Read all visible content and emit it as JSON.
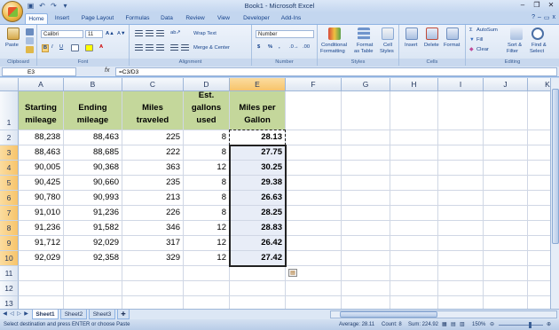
{
  "window": {
    "title": "Book1 - Microsoft Excel",
    "controls": [
      "–",
      "❐",
      "✕"
    ]
  },
  "ribbon_tabs": [
    "Home",
    "Insert",
    "Page Layout",
    "Formulas",
    "Data",
    "Review",
    "View",
    "Developer",
    "Add-Ins"
  ],
  "ribbon": {
    "clipboard": {
      "paste": "Paste",
      "label": "Clipboard"
    },
    "font": {
      "name": "Calibri",
      "size": "11",
      "label": "Font"
    },
    "alignment": {
      "wrap_text": "Wrap Text",
      "merge": "Merge & Center",
      "label": "Alignment"
    },
    "number": {
      "format": "Number",
      "label": "Number"
    },
    "styles": {
      "conditional": "Conditional",
      "conditional2": "Formatting",
      "format_as": "Format",
      "format_as2": "as Table",
      "cell": "Cell",
      "cell2": "Styles",
      "label": "Styles"
    },
    "cells": {
      "insert": "Insert",
      "delete": "Delete",
      "format": "Format",
      "label": "Cells"
    },
    "editing": {
      "autosum": "AutoSum",
      "fill": "Fill",
      "clear": "Clear",
      "sort": "Sort &",
      "sort2": "Filter",
      "find": "Find &",
      "find2": "Select",
      "label": "Editing"
    }
  },
  "formula_bar": {
    "name_box": "E3",
    "fx": "fx",
    "formula": "=C3/D3"
  },
  "columns": [
    "A",
    "B",
    "C",
    "D",
    "E",
    "F",
    "G",
    "H",
    "I",
    "J",
    "K"
  ],
  "rows": [
    "1",
    "2",
    "3",
    "4",
    "5",
    "6",
    "7",
    "8",
    "9",
    "10",
    "11",
    "12",
    "13"
  ],
  "headers": [
    "Starting mileage",
    "Ending mileage",
    "Miles traveled",
    "Est. gallons used",
    "Miles per Gallon"
  ],
  "data_rows": [
    [
      "88,238",
      "88,463",
      "225",
      "8",
      "28.13"
    ],
    [
      "88,463",
      "88,685",
      "222",
      "8",
      "27.75"
    ],
    [
      "90,005",
      "90,368",
      "363",
      "12",
      "30.25"
    ],
    [
      "90,425",
      "90,660",
      "235",
      "8",
      "29.38"
    ],
    [
      "90,780",
      "90,993",
      "213",
      "8",
      "26.63"
    ],
    [
      "91,010",
      "91,236",
      "226",
      "8",
      "28.25"
    ],
    [
      "91,236",
      "91,582",
      "346",
      "12",
      "28.83"
    ],
    [
      "91,712",
      "92,029",
      "317",
      "12",
      "26.42"
    ],
    [
      "92,029",
      "92,358",
      "329",
      "12",
      "27.42"
    ]
  ],
  "sheets": [
    "Sheet1",
    "Sheet2",
    "Sheet3"
  ],
  "status": {
    "message": "Select destination and press ENTER or choose Paste",
    "average": "Average: 28.11",
    "count": "Count: 8",
    "sum": "Sum: 224.92",
    "zoom": "150%"
  },
  "colors": {
    "header_fill": "#c4d79b",
    "selection_fill": "#e8edf7",
    "ribbon": "#d8e4f3"
  }
}
